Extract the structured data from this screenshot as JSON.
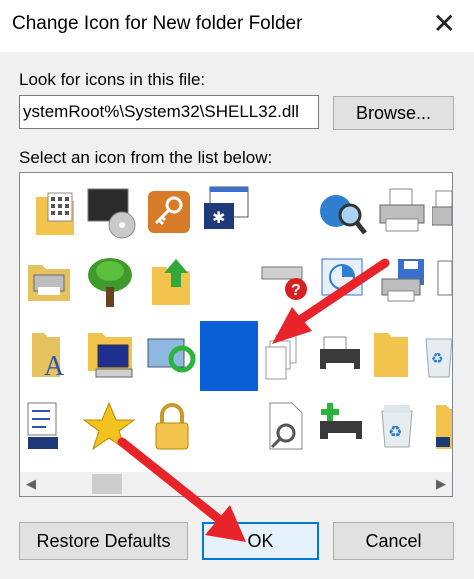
{
  "dialog": {
    "title": "Change Icon for New folder Folder",
    "close_glyph": "✕"
  },
  "file_section": {
    "label": "Look for icons in this file:",
    "path_value": "ystemRoot%\\System32\\SHELL32.dll",
    "browse_label": "Browse..."
  },
  "list_section": {
    "label": "Select an icon from the list below:",
    "selected_icon": "blank-icon",
    "icons": [
      "folder-grid-icon",
      "monitor-disc-icon",
      "key-icon",
      "window-computer-icon",
      "blank-icon",
      "globe-search-icon",
      "printer-icon",
      "printer-partial-icon",
      "folder-printer-icon",
      "tree-icon",
      "folder-upload-icon",
      "blank-icon",
      "drive-help-icon",
      "window-chart-icon",
      "printer-disk-icon",
      "window-partial-icon",
      "folder-font-icon",
      "folder-computer-icon",
      "sync-icon",
      "selected-blank-icon",
      "pages-icon",
      "fax-printer-icon",
      "folder-icon",
      "recycle-bin-icon",
      "checklist-icon",
      "star-icon",
      "lock-icon",
      "blank-icon",
      "document-search-icon",
      "printer-add-icon",
      "recycle-bin-full-icon",
      "folder-partial-icon"
    ]
  },
  "buttons": {
    "restore_label": "Restore Defaults",
    "ok_label": "OK",
    "cancel_label": "Cancel"
  },
  "colors": {
    "selection": "#0a5fd6",
    "annotation_arrow": "#e8242a",
    "default_button_border": "#0078d7"
  }
}
